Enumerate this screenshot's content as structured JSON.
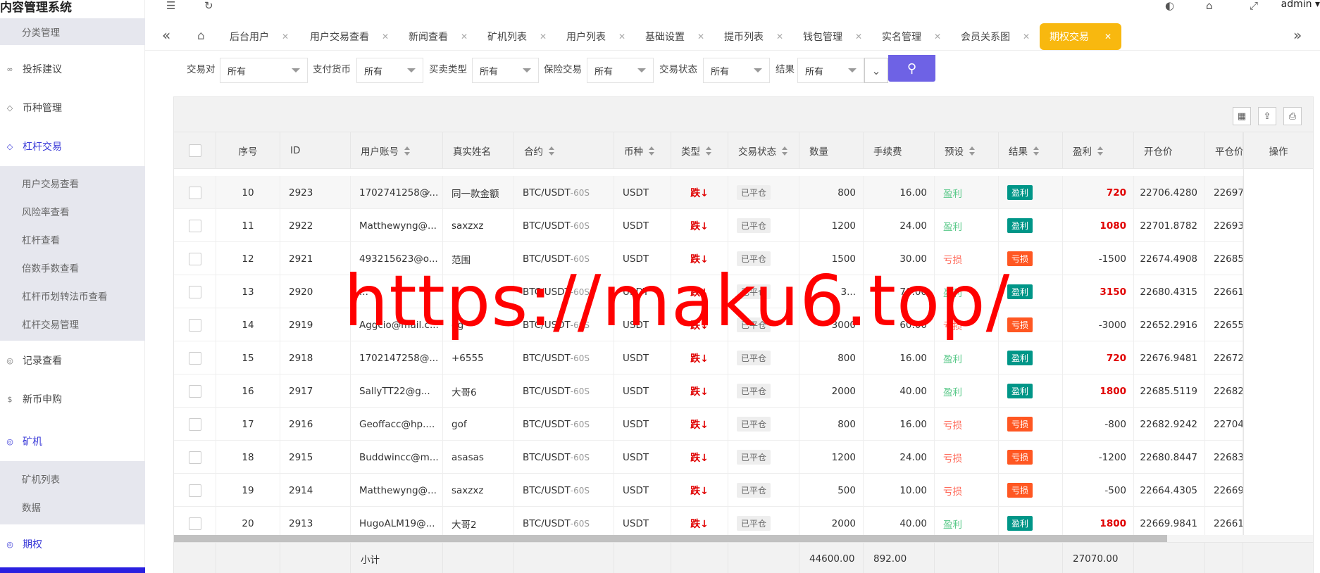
{
  "brand": "内容管理系统",
  "header": {
    "user": "admin"
  },
  "sidebar": {
    "top_sub": "分类管理",
    "items": [
      {
        "label": "投拆建议",
        "icon": "link-icon"
      },
      {
        "label": "币种管理",
        "icon": "diamond-icon"
      },
      {
        "label": "杠杆交易",
        "icon": "diamond-icon",
        "active": true
      },
      {
        "label": "记录查看",
        "icon": "circle-icon"
      },
      {
        "label": "新币申购",
        "icon": "dollar-icon"
      },
      {
        "label": "矿机",
        "icon": "circle-icon",
        "active": true
      },
      {
        "label": "期权",
        "icon": "circle-icon",
        "active": true
      }
    ],
    "leverage_sub": [
      "用户交易查看",
      "风险率查看",
      "杠杆查看",
      "倍数手数查看",
      "杠杆币划转法币查看",
      "杠杆交易管理"
    ],
    "miner_sub": [
      "矿机列表",
      "数据"
    ]
  },
  "tabs": [
    "后台用户",
    "用户交易查看",
    "新闻查看",
    "矿机列表",
    "用户列表",
    "基础设置",
    "提币列表",
    "钱包管理",
    "实名管理",
    "会员关系图",
    "期权交易"
  ],
  "filters": [
    {
      "label": "交易对",
      "value": "所有"
    },
    {
      "label": "支付货币",
      "value": "所有"
    },
    {
      "label": "买卖类型",
      "value": "所有"
    },
    {
      "label": "保险交易",
      "value": "所有"
    },
    {
      "label": "交易状态",
      "value": "所有"
    },
    {
      "label": "结果",
      "value": "所有"
    }
  ],
  "table": {
    "headers": {
      "seq": "序号",
      "id": "ID",
      "account": "用户账号",
      "name": "真实姓名",
      "contract": "合约",
      "coin": "币种",
      "type": "类型",
      "status": "交易状态",
      "qty": "数量",
      "fee": "手续费",
      "preset": "预设",
      "result": "结果",
      "pl": "盈利",
      "open": "开仓价",
      "close": "平仓价",
      "op": "操作"
    },
    "rows": [
      {
        "seq": "10",
        "id": "2923",
        "account": "1702741258@...",
        "name": "同一款金额",
        "contract": "BTC/USDT",
        "suffix": "-60S",
        "coin": "USDT",
        "type": "跌↓",
        "status": "已平仓",
        "qty": "800",
        "fee": "16.00",
        "preset": "盈利",
        "result": "盈利",
        "pl": "720",
        "open": "22706.4280",
        "close": "22697",
        "win": true
      },
      {
        "seq": "11",
        "id": "2922",
        "account": "Matthewyng@...",
        "name": "saxzxz",
        "contract": "BTC/USDT",
        "suffix": "-60S",
        "coin": "USDT",
        "type": "跌↓",
        "status": "已平仓",
        "qty": "1200",
        "fee": "24.00",
        "preset": "盈利",
        "result": "盈利",
        "pl": "1080",
        "open": "22701.8782",
        "close": "22693",
        "win": true
      },
      {
        "seq": "12",
        "id": "2921",
        "account": "493215623@o...",
        "name": "范围",
        "contract": "BTC/USDT",
        "suffix": "-60S",
        "coin": "USDT",
        "type": "跌↓",
        "status": "已平仓",
        "qty": "1500",
        "fee": "30.00",
        "preset": "亏损",
        "result": "亏损",
        "pl": "-1500",
        "open": "22674.4908",
        "close": "22685",
        "win": false
      },
      {
        "seq": "13",
        "id": "2920",
        "account": "...",
        "name": "...",
        "contract": "BTC/USDT",
        "suffix": "-60S",
        "coin": "USDT",
        "type": "跌↓",
        "status": "已平仓",
        "qty": "3...",
        "fee": "70.00",
        "preset": "盈利",
        "result": "盈利",
        "pl": "3150",
        "open": "22680.4315",
        "close": "22661",
        "win": true
      },
      {
        "seq": "14",
        "id": "2919",
        "account": "Aggcio@mail.c...",
        "name": "gg",
        "contract": "BTC/USDT",
        "suffix": "-60S",
        "coin": "USDT",
        "type": "跌↓",
        "status": "已平仓",
        "qty": "3000",
        "fee": "60.00",
        "preset": "亏损",
        "result": "亏损",
        "pl": "-3000",
        "open": "22652.2916",
        "close": "22655",
        "win": false
      },
      {
        "seq": "15",
        "id": "2918",
        "account": "1702147258@...",
        "name": "+6555",
        "contract": "BTC/USDT",
        "suffix": "-60S",
        "coin": "USDT",
        "type": "跌↓",
        "status": "已平仓",
        "qty": "800",
        "fee": "16.00",
        "preset": "盈利",
        "result": "盈利",
        "pl": "720",
        "open": "22676.9481",
        "close": "22672",
        "win": true
      },
      {
        "seq": "16",
        "id": "2917",
        "account": "SallyTT22@g...",
        "name": "大哥6",
        "contract": "BTC/USDT",
        "suffix": "-60S",
        "coin": "USDT",
        "type": "跌↓",
        "status": "已平仓",
        "qty": "2000",
        "fee": "40.00",
        "preset": "盈利",
        "result": "盈利",
        "pl": "1800",
        "open": "22685.5119",
        "close": "22682",
        "win": true
      },
      {
        "seq": "17",
        "id": "2916",
        "account": "Geoffacc@hp....",
        "name": "gof",
        "contract": "BTC/USDT",
        "suffix": "-60S",
        "coin": "USDT",
        "type": "跌↓",
        "status": "已平仓",
        "qty": "800",
        "fee": "16.00",
        "preset": "亏损",
        "result": "亏损",
        "pl": "-800",
        "open": "22682.9242",
        "close": "22704",
        "win": false
      },
      {
        "seq": "18",
        "id": "2915",
        "account": "Buddwincc@m...",
        "name": "asasas",
        "contract": "BTC/USDT",
        "suffix": "-60S",
        "coin": "USDT",
        "type": "跌↓",
        "status": "已平仓",
        "qty": "1200",
        "fee": "24.00",
        "preset": "亏损",
        "result": "亏损",
        "pl": "-1200",
        "open": "22680.8447",
        "close": "22683",
        "win": false
      },
      {
        "seq": "19",
        "id": "2914",
        "account": "Matthewyng@...",
        "name": "saxzxz",
        "contract": "BTC/USDT",
        "suffix": "-60S",
        "coin": "USDT",
        "type": "跌↓",
        "status": "已平仓",
        "qty": "500",
        "fee": "10.00",
        "preset": "亏损",
        "result": "亏损",
        "pl": "-500",
        "open": "22664.4305",
        "close": "22669",
        "win": false
      },
      {
        "seq": "20",
        "id": "2913",
        "account": "HugoALM19@...",
        "name": "大哥2",
        "contract": "BTC/USDT",
        "suffix": "-60S",
        "coin": "USDT",
        "type": "跌↓",
        "status": "已平仓",
        "qty": "2000",
        "fee": "40.00",
        "preset": "盈利",
        "result": "盈利",
        "pl": "1800",
        "open": "22669.9841",
        "close": "22661",
        "win": true
      }
    ],
    "footer": {
      "label": "小计",
      "qty": "44600.00",
      "fee": "892.00",
      "pl": "27070.00"
    }
  },
  "watermark": "https://maku6.top/",
  "colors": {
    "accent": "#3a3ad8",
    "active_tab": "#f8b80f",
    "search_btn": "#6e62e5",
    "win": "#009688",
    "loss": "#ff5722",
    "watermark": "#ff0000"
  }
}
